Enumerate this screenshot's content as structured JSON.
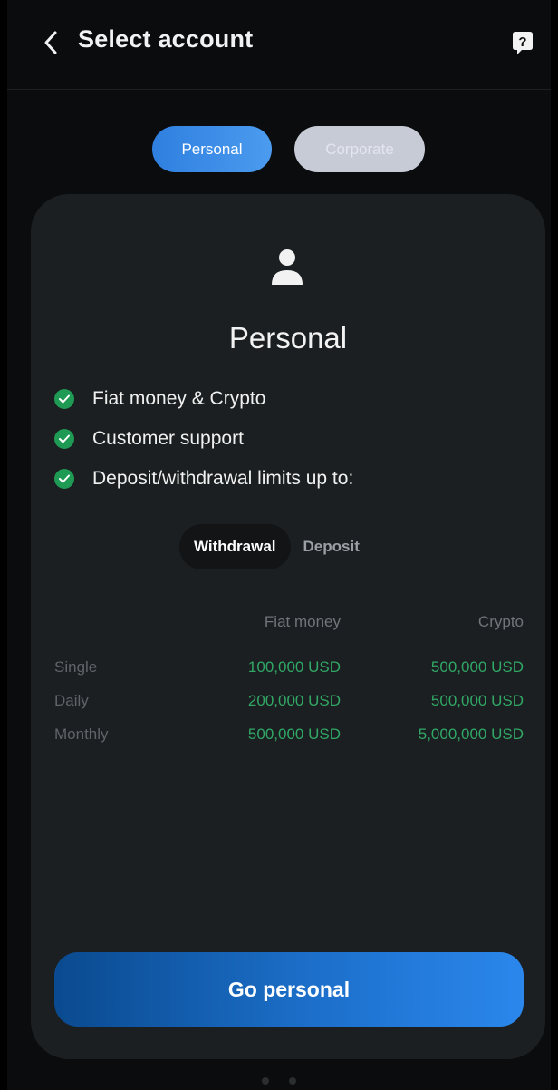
{
  "header": {
    "title": "Select account"
  },
  "tabs": [
    {
      "label": "Personal",
      "active": true
    },
    {
      "label": "Corporate",
      "active": false
    }
  ],
  "card": {
    "title": "Personal",
    "features": [
      "Fiat money & Crypto",
      "Customer support",
      "Deposit/withdrawal limits up to:"
    ],
    "limit_toggle": {
      "selected": "Withdrawal",
      "other": "Deposit"
    },
    "table": {
      "columns": [
        "Fiat money",
        "Crypto"
      ],
      "rows": [
        {
          "label": "Single",
          "fiat": "100,000 USD",
          "crypto": "500,000 USD"
        },
        {
          "label": "Daily",
          "fiat": "200,000 USD",
          "crypto": "500,000 USD"
        },
        {
          "label": "Monthly",
          "fiat": "500,000 USD",
          "crypto": "5,000,000 USD"
        }
      ]
    },
    "cta_label": "Go personal"
  },
  "pager": {
    "count": 2,
    "active_index": 0
  },
  "colors": {
    "accent": "#3b8ff0",
    "positive": "#31a866",
    "check": "#1f9a54"
  }
}
